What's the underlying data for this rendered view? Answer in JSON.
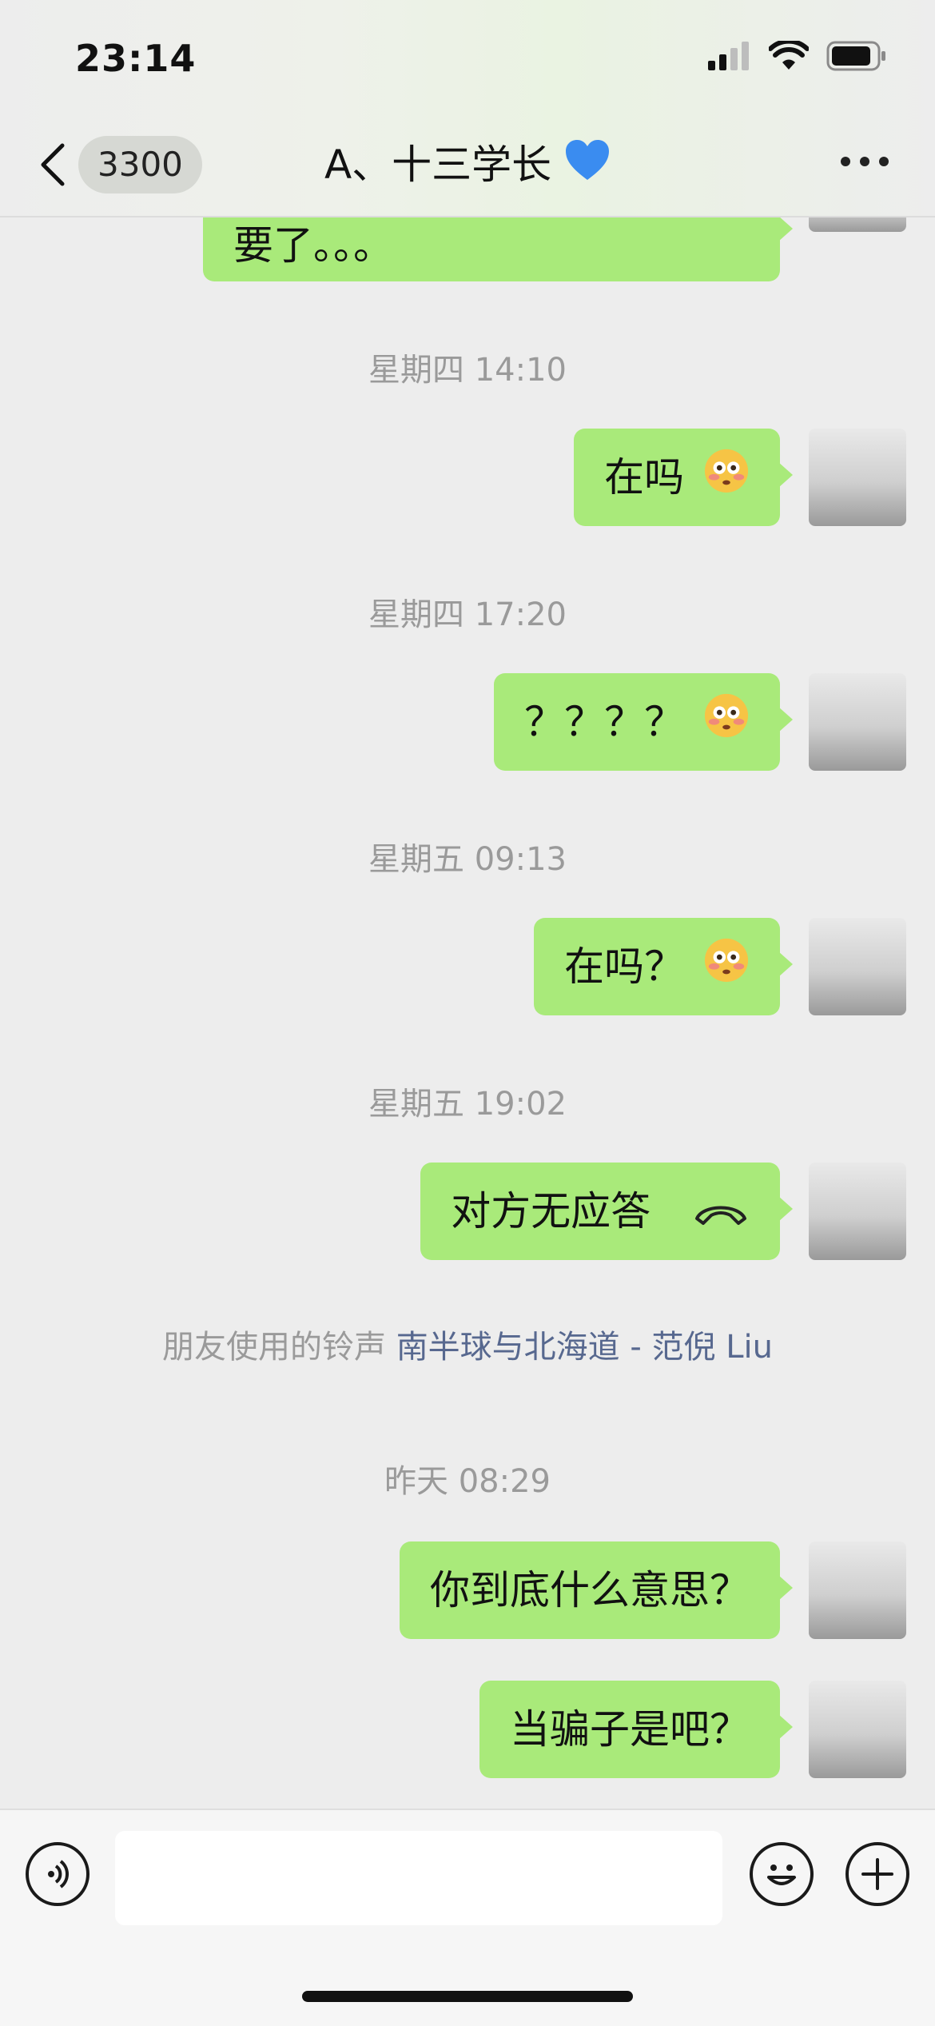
{
  "status_bar": {
    "time": "23:14",
    "signal_icon": "signal-bars",
    "wifi_icon": "wifi",
    "battery_icon": "battery"
  },
  "nav": {
    "unread_count": "3300",
    "title": "A、十三学长",
    "title_emoji": "blue-heart",
    "more_icon": "more-dots"
  },
  "messages": [
    {
      "type": "text",
      "text": "要了。。。"
    },
    {
      "type": "timestamp",
      "text": "星期四 14:10"
    },
    {
      "type": "text",
      "text": "在吗",
      "emoji": "flushed-face"
    },
    {
      "type": "timestamp",
      "text": "星期四 17:20"
    },
    {
      "type": "text",
      "text": "？？？？",
      "emoji": "flushed-face"
    },
    {
      "type": "timestamp",
      "text": "星期五 09:13"
    },
    {
      "type": "text",
      "text": "在吗？",
      "emoji": "flushed-face"
    },
    {
      "type": "timestamp",
      "text": "星期五 19:02"
    },
    {
      "type": "call",
      "text": "对方无应答",
      "icon": "hang-up-phone"
    },
    {
      "type": "ringtone",
      "prefix": "朋友使用的铃声",
      "song": "南半球与北海道 - 范倪 Liu"
    },
    {
      "type": "timestamp",
      "text": "昨天 08:29"
    },
    {
      "type": "text",
      "text": "你到底什么意思？"
    },
    {
      "type": "text",
      "text": "当骗子是吧？"
    }
  ],
  "input_bar": {
    "voice_icon": "voice",
    "emoji_icon": "smile",
    "plus_icon": "plus",
    "text_value": ""
  },
  "colors": {
    "bubble": "#a9ea7a",
    "link": "#57688f",
    "timestamp": "#9a9a9a"
  }
}
